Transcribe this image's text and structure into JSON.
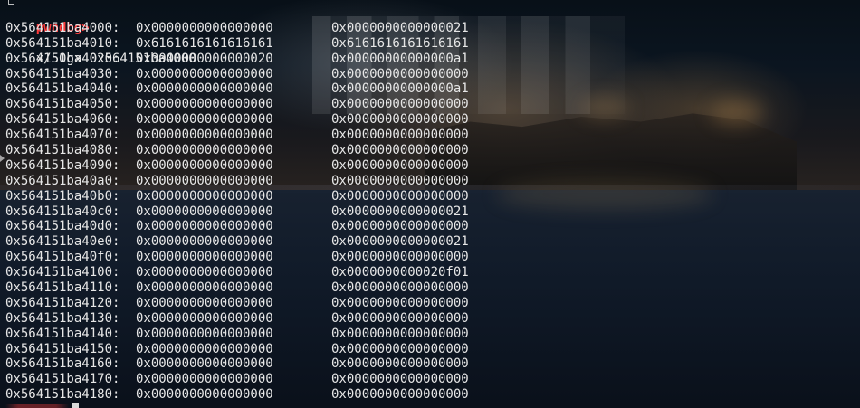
{
  "terminal": {
    "prompt": "pwndbg>",
    "command": "x/50gx 0x564151ba4000",
    "rows": [
      {
        "address": "0x564151ba4000:",
        "word1": "0x0000000000000000",
        "word2": "0x0000000000000021"
      },
      {
        "address": "0x564151ba4010:",
        "word1": "0x6161616161616161",
        "word2": "0x6161616161616161"
      },
      {
        "address": "0x564151ba4020:",
        "word1": "0x0000000000000020",
        "word2": "0x00000000000000a1"
      },
      {
        "address": "0x564151ba4030:",
        "word1": "0x0000000000000000",
        "word2": "0x0000000000000000"
      },
      {
        "address": "0x564151ba4040:",
        "word1": "0x0000000000000000",
        "word2": "0x00000000000000a1"
      },
      {
        "address": "0x564151ba4050:",
        "word1": "0x0000000000000000",
        "word2": "0x0000000000000000"
      },
      {
        "address": "0x564151ba4060:",
        "word1": "0x0000000000000000",
        "word2": "0x0000000000000000"
      },
      {
        "address": "0x564151ba4070:",
        "word1": "0x0000000000000000",
        "word2": "0x0000000000000000"
      },
      {
        "address": "0x564151ba4080:",
        "word1": "0x0000000000000000",
        "word2": "0x0000000000000000"
      },
      {
        "address": "0x564151ba4090:",
        "word1": "0x0000000000000000",
        "word2": "0x0000000000000000"
      },
      {
        "address": "0x564151ba40a0:",
        "word1": "0x0000000000000000",
        "word2": "0x0000000000000000"
      },
      {
        "address": "0x564151ba40b0:",
        "word1": "0x0000000000000000",
        "word2": "0x0000000000000000"
      },
      {
        "address": "0x564151ba40c0:",
        "word1": "0x0000000000000000",
        "word2": "0x0000000000000021"
      },
      {
        "address": "0x564151ba40d0:",
        "word1": "0x0000000000000000",
        "word2": "0x0000000000000000"
      },
      {
        "address": "0x564151ba40e0:",
        "word1": "0x0000000000000000",
        "word2": "0x0000000000000021"
      },
      {
        "address": "0x564151ba40f0:",
        "word1": "0x0000000000000000",
        "word2": "0x0000000000000000"
      },
      {
        "address": "0x564151ba4100:",
        "word1": "0x0000000000000000",
        "word2": "0x0000000000020f01"
      },
      {
        "address": "0x564151ba4110:",
        "word1": "0x0000000000000000",
        "word2": "0x0000000000000000"
      },
      {
        "address": "0x564151ba4120:",
        "word1": "0x0000000000000000",
        "word2": "0x0000000000000000"
      },
      {
        "address": "0x564151ba4130:",
        "word1": "0x0000000000000000",
        "word2": "0x0000000000000000"
      },
      {
        "address": "0x564151ba4140:",
        "word1": "0x0000000000000000",
        "word2": "0x0000000000000000"
      },
      {
        "address": "0x564151ba4150:",
        "word1": "0x0000000000000000",
        "word2": "0x0000000000000000"
      },
      {
        "address": "0x564151ba4160:",
        "word1": "0x0000000000000000",
        "word2": "0x0000000000000000"
      },
      {
        "address": "0x564151ba4170:",
        "word1": "0x0000000000000000",
        "word2": "0x0000000000000000"
      },
      {
        "address": "0x564151ba4180:",
        "word1": "0x0000000000000000",
        "word2": "0x0000000000000000"
      }
    ]
  },
  "colors": {
    "prompt": "#ff3b3b",
    "text": "#e6e6e6"
  }
}
